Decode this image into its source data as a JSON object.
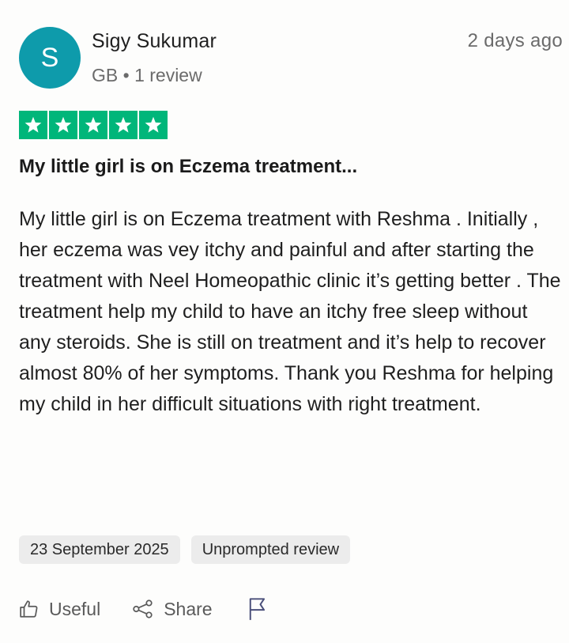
{
  "reviewer": {
    "initial": "S",
    "name": "Sigy Sukumar",
    "meta": "GB • 1 review",
    "time_ago": "2 days ago",
    "avatar_color": "#0e9bab"
  },
  "rating": {
    "value": 5,
    "max": 5,
    "star_color": "#00b67a"
  },
  "review": {
    "title": "My little girl is on Eczema treatment...",
    "body": "My little girl is on Eczema treatment with Reshma . Initially , her eczema was vey itchy and painful and after starting the treatment with Neel Homeopathic clinic it’s getting better . The treatment help my child to have an itchy free sleep without any steroids. She is still on treatment and it’s help to recover almost 80% of her symptoms. Thank you Reshma for helping my child in her difficult situations with right treatment."
  },
  "tags": {
    "date": "23 September 2025",
    "type": "Unprompted review"
  },
  "actions": {
    "useful_label": "Useful",
    "share_label": "Share",
    "icons": [
      "thumbs-up-icon",
      "share-icon",
      "flag-icon"
    ]
  }
}
